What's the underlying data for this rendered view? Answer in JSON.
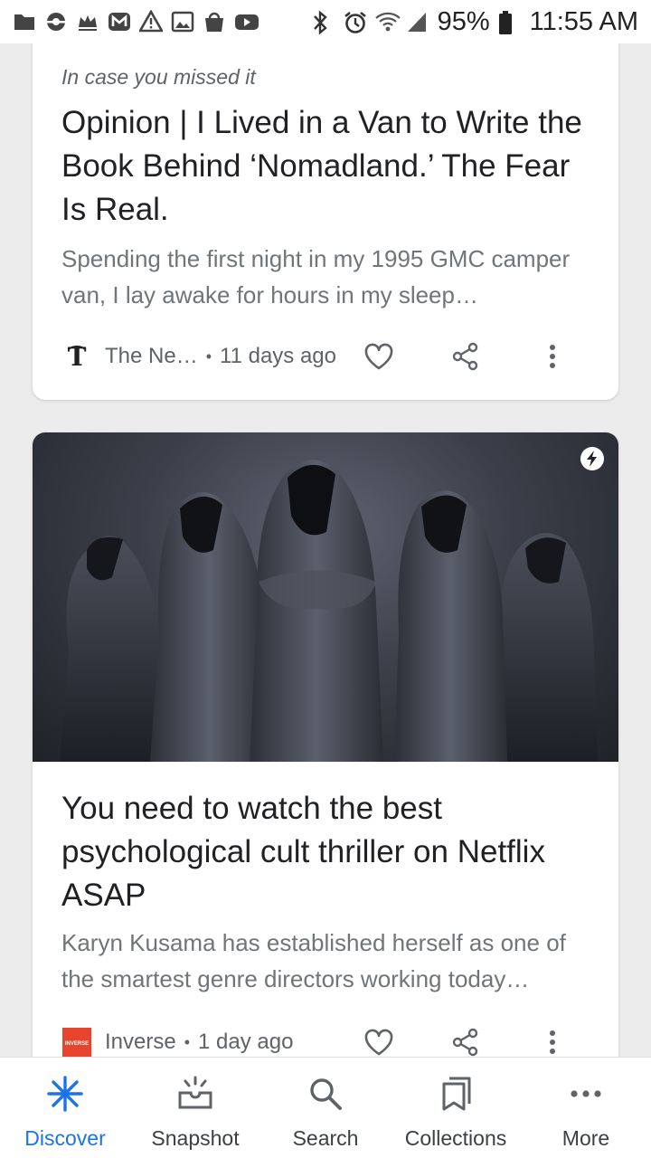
{
  "status_bar": {
    "battery": "95%",
    "time": "11:55 AM"
  },
  "cards": [
    {
      "eyebrow": "In case you missed it",
      "headline": "Opinion | I Lived in a Van to Write the Book Behind ‘Nomadland.’ The Fear Is Real.",
      "snippet": "Spending the first night in my 1995 GMC camper van, I lay awake for hours in my sleep…",
      "source": "The Ne…",
      "separator": "•",
      "time": "11 days ago"
    },
    {
      "headline": "You need to watch the best psychological cult thriller on Netflix ASAP",
      "snippet": "Karyn Kusama has established herself as one of the smartest genre directors working today…",
      "source": "Inverse",
      "separator": "•",
      "time": "1 day ago",
      "logo_text": "INVERSE"
    }
  ],
  "bottom_nav": [
    {
      "label": "Discover",
      "icon": "asterisk-icon",
      "active": true
    },
    {
      "label": "Snapshot",
      "icon": "snapshot-icon",
      "active": false
    },
    {
      "label": "Search",
      "icon": "search-icon",
      "active": false
    },
    {
      "label": "Collections",
      "icon": "collections-icon",
      "active": false
    },
    {
      "label": "More",
      "icon": "more-dots-icon",
      "active": false
    }
  ],
  "colors": {
    "accent": "#1a73e8",
    "headline": "#202124",
    "snippet": "#70757a",
    "meta": "#5f6368"
  }
}
